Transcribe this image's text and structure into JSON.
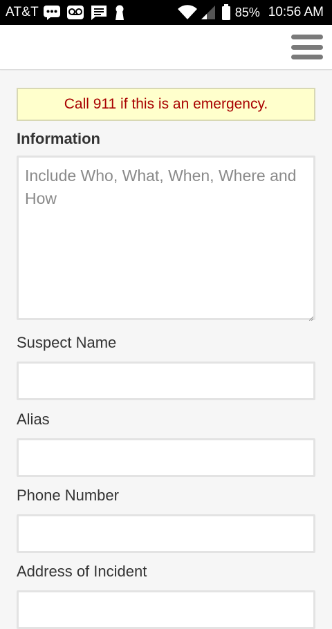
{
  "status_bar": {
    "carrier": "AT&T",
    "battery_percent": "85%",
    "time": "10:56 AM",
    "icons": [
      "messages-icon",
      "voicemail-icon",
      "chat-icon",
      "keyhole-icon",
      "wifi-icon",
      "signal-icon",
      "battery-icon"
    ]
  },
  "app_bar": {
    "menu_icon": "hamburger-menu-icon"
  },
  "form": {
    "alert_text": "Call 911 if this is an emergency.",
    "section_title": "Information",
    "information": {
      "placeholder": "Include Who, What, When, Where and How",
      "value": ""
    },
    "fields": [
      {
        "label": "Suspect Name",
        "value": ""
      },
      {
        "label": "Alias",
        "value": ""
      },
      {
        "label": "Phone Number",
        "value": ""
      },
      {
        "label": "Address of Incident",
        "value": ""
      }
    ]
  },
  "colors": {
    "alert_background": "#ffffcc",
    "alert_text": "#a80000",
    "page_background": "#f6f6f6"
  }
}
